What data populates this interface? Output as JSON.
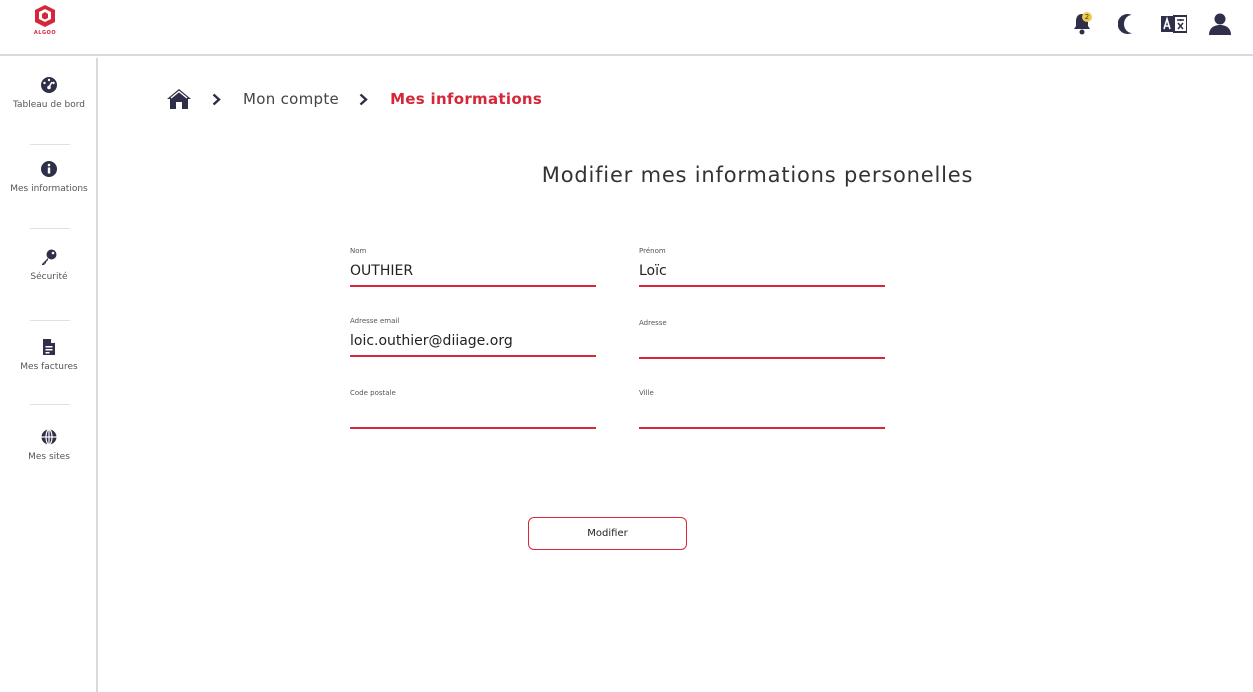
{
  "brand": {
    "name": "ALGOO",
    "accent_color": "#d6273a"
  },
  "header": {
    "notifications": {
      "icon": "bell-icon",
      "badge_count": "2"
    },
    "theme_toggle": {
      "icon": "moon-icon"
    },
    "language": {
      "icon": "translate-icon"
    },
    "profile": {
      "icon": "user-icon"
    }
  },
  "sidebar": {
    "items": [
      {
        "label": "Tableau de bord",
        "icon": "dashboard-gauge-icon"
      },
      {
        "label": "Mes informations",
        "icon": "info-icon"
      },
      {
        "label": "Sécurité",
        "icon": "key-icon"
      },
      {
        "label": "Mes factures",
        "icon": "invoice-icon"
      },
      {
        "label": "Mes sites",
        "icon": "globe-icon"
      }
    ]
  },
  "breadcrumb": {
    "home_icon": "home-icon",
    "items": [
      "Mon compte",
      "Mes informations"
    ]
  },
  "main": {
    "title": "Modifier mes informations personelles",
    "fields": {
      "nom": {
        "label": "Nom",
        "value": "OUTHIER"
      },
      "prenom": {
        "label": "Prénom",
        "value": "Loïc"
      },
      "email": {
        "label": "Adresse email",
        "value": "loic.outhier@diiage.org"
      },
      "adresse": {
        "label": "Adresse",
        "value": ""
      },
      "code_postale": {
        "label": "Code postale",
        "value": ""
      },
      "ville": {
        "label": "Ville",
        "value": ""
      }
    },
    "submit_label": "Modifier"
  }
}
